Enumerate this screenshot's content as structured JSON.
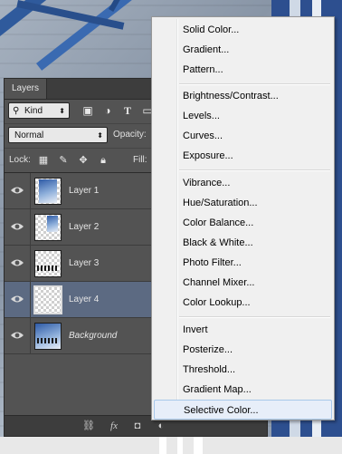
{
  "panel": {
    "tab_label": "Layers",
    "kind_filter": {
      "icon": "search-icon",
      "value": "Kind"
    },
    "filter_icons": [
      "image-filter-icon",
      "adjustment-filter-icon",
      "type-filter-icon",
      "shape-filter-icon"
    ],
    "filter_glyphs": [
      "▣",
      "◑",
      "T",
      "▭"
    ],
    "blend_mode": "Normal",
    "opacity_label": "Opacity:",
    "lock_label": "Lock:",
    "fill_label": "Fill:",
    "layers": [
      {
        "name": "Layer 1",
        "visible": true,
        "selected": false,
        "italic": false,
        "thumb": "photo-tall"
      },
      {
        "name": "Layer 2",
        "visible": true,
        "selected": false,
        "italic": false,
        "thumb": "photo-small"
      },
      {
        "name": "Layer 3",
        "visible": true,
        "selected": false,
        "italic": false,
        "thumb": "skyline"
      },
      {
        "name": "Layer 4",
        "visible": true,
        "selected": true,
        "italic": false,
        "thumb": "empty"
      },
      {
        "name": "Background",
        "visible": true,
        "selected": false,
        "italic": true,
        "thumb": "photo-full"
      }
    ],
    "footer_icons": [
      "link-icon",
      "fx-icon",
      "mask-icon",
      "adjustment-icon"
    ],
    "footer_glyphs": [
      "⛓",
      "fx",
      "◘",
      "◐"
    ]
  },
  "menu": {
    "groups": [
      [
        "Solid Color...",
        "Gradient...",
        "Pattern..."
      ],
      [
        "Brightness/Contrast...",
        "Levels...",
        "Curves...",
        "Exposure..."
      ],
      [
        "Vibrance...",
        "Hue/Saturation...",
        "Color Balance...",
        "Black & White...",
        "Photo Filter...",
        "Channel Mixer...",
        "Color Lookup..."
      ],
      [
        "Invert",
        "Posterize...",
        "Threshold...",
        "Gradient Map...",
        "Selective Color..."
      ]
    ],
    "hovered_item": "Selective Color..."
  },
  "colors": {
    "panel_bg": "#535353",
    "selected_layer": "#5c6a82",
    "menu_bg": "#f0f0f0",
    "menu_hover": "#e7eef9"
  }
}
